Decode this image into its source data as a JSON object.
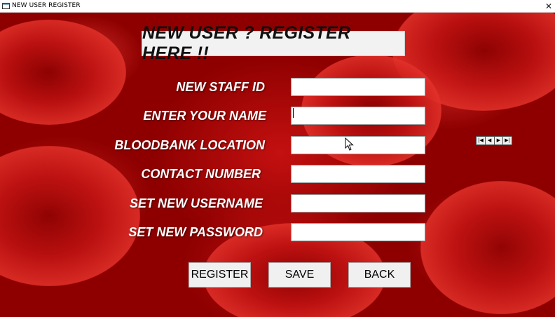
{
  "window": {
    "title": "NEW USER REGISTER",
    "close_glyph": "✕",
    "app_icon": "app-window-icon"
  },
  "banner": {
    "text": "NEW USER ? REGISTER HERE !!"
  },
  "form": {
    "fields": [
      {
        "label": "NEW STAFF ID",
        "value": ""
      },
      {
        "label": "ENTER YOUR NAME",
        "value": ""
      },
      {
        "label": "BLOODBANK LOCATION",
        "value": ""
      },
      {
        "label": "CONTACT NUMBER",
        "value": ""
      },
      {
        "label": "SET NEW USERNAME",
        "value": ""
      },
      {
        "label": "SET NEW PASSWORD",
        "value": ""
      }
    ]
  },
  "buttons": {
    "register": "REGISTER",
    "save": "SAVE",
    "back": "BACK"
  },
  "navigator": {
    "first": "|◀",
    "prev": "◀",
    "next": "▶",
    "last": "▶|"
  },
  "colors": {
    "background": "#b00b0b",
    "banner_bg": "#f2f2f2",
    "label_text": "#ffffff",
    "button_bg": "#f0f0f0"
  }
}
